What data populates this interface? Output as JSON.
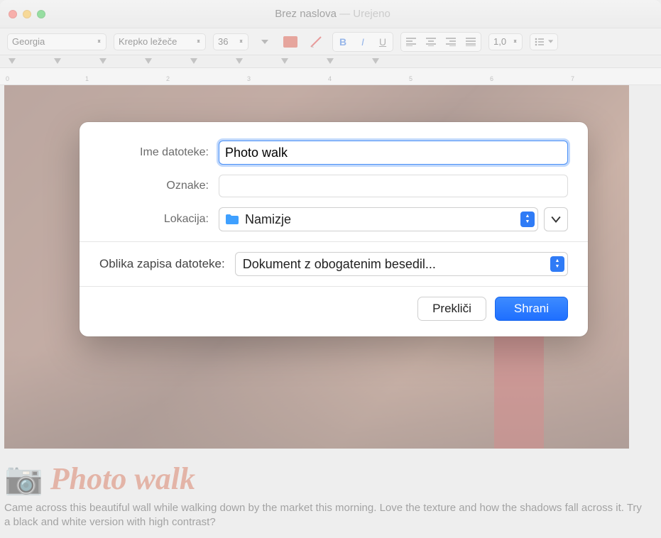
{
  "title": {
    "main": "Brez naslova",
    "sep": " — ",
    "state": "Urejeno"
  },
  "toolbar": {
    "font_name": "Georgia",
    "font_style": "Krepko ležeče",
    "font_size": "36",
    "line_height": "1,0"
  },
  "ruler": {
    "numbers": [
      "0",
      "1",
      "2",
      "3",
      "4",
      "5",
      "6",
      "7"
    ]
  },
  "document": {
    "heading": "Photo walk",
    "body": "Came across this beautiful wall while walking down by the market this morning. Love the texture and how the shadows fall across it. Try a black and white version with high contrast?"
  },
  "dialog": {
    "filename_label": "Ime datoteke:",
    "filename_value": "Photo walk",
    "tags_label": "Oznake:",
    "location_label": "Lokacija:",
    "location_value": "Namizje",
    "format_label": "Oblika zapisa datoteke:",
    "format_value": "Dokument z obogatenim besedil...",
    "cancel": "Prekliči",
    "save": "Shrani"
  }
}
